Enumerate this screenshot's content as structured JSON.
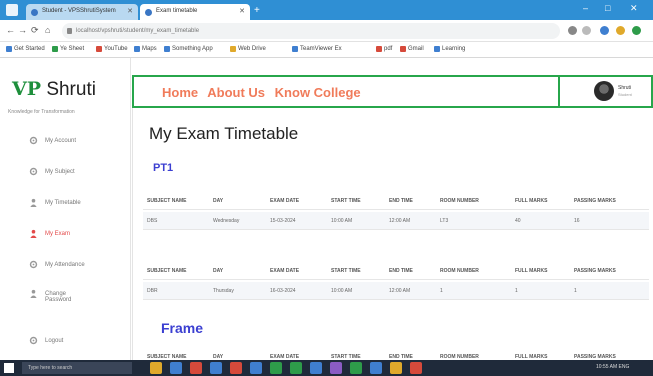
{
  "browser": {
    "tabs": [
      {
        "title": "Student - VPSShrutiSystem"
      },
      {
        "title": "Exam timetable"
      }
    ],
    "new_tab_symbol": "+",
    "window_controls": {
      "min": "–",
      "max": "□",
      "close": "✕"
    },
    "url": "localhost/vpshruti/student/my_exam_timetable",
    "nav": {
      "back": "←",
      "forward": "→",
      "reload": "⟳",
      "home": "⌂"
    },
    "bookmarks": [
      {
        "label": "Get Started",
        "color": "#3f7fd0"
      },
      {
        "label": "Ye Sheet",
        "color": "#2e9c4a"
      },
      {
        "label": "YouTube",
        "color": "#d64a3b"
      },
      {
        "label": "Maps",
        "color": "#3f7fd0"
      },
      {
        "label": "Something App",
        "color": "#3f7fd0"
      },
      {
        "label": "Web Drive",
        "color": "#e0a92b"
      },
      {
        "label": "TeamViewer Ex",
        "color": "#3f7fd0"
      },
      {
        "label": "pdf",
        "color": "#d64a3b"
      },
      {
        "label": "Gmail",
        "color": "#d64a3b"
      },
      {
        "label": "Learning",
        "color": "#3f7fd0"
      }
    ]
  },
  "sidebar": {
    "logo_mark": "VP",
    "logo_text": "Shruti",
    "tagline": "Knowledge for Transformation",
    "items": [
      {
        "label": "My Account",
        "icon": "gear-icon"
      },
      {
        "label": "My Subject",
        "icon": "gear-icon"
      },
      {
        "label": "My Timetable",
        "icon": "person-icon"
      },
      {
        "label": "My Exam",
        "icon": "person-icon",
        "active": true
      },
      {
        "label": "My Attendance",
        "icon": "gear-icon"
      },
      {
        "label": "Change",
        "label2": "Password",
        "icon": "person-icon"
      },
      {
        "label": "Logout",
        "icon": "gear-icon"
      }
    ]
  },
  "header": {
    "nav": [
      "Home",
      "About Us",
      "Know College"
    ],
    "user_name": "Shruti",
    "user_role": "Student",
    "colors": {
      "border": "#27a64b",
      "nav_text": "#f07b5a"
    }
  },
  "main": {
    "title": "My Exam Timetable",
    "columns": [
      "SUBJECT NAME",
      "DAY",
      "EXAM DATE",
      "START TIME",
      "END TIME",
      "ROOM NUMBER",
      "FULL MARKS",
      "PASSING MARKS"
    ],
    "exams": [
      {
        "name": "PT1",
        "rows": [
          [
            "DBS",
            "Wednesday",
            "15-03-2024",
            "10:00 AM",
            "12:00 AM",
            "LT3",
            "40",
            "16"
          ]
        ]
      },
      {
        "name": "",
        "rows": [
          [
            "DBR",
            "Thursday",
            "16-03-2024",
            "10:00 AM",
            "12:00 AM",
            "1",
            "1",
            "1"
          ]
        ]
      },
      {
        "name": "Frame",
        "rows": []
      }
    ],
    "accent_color": "#3b3fd1"
  },
  "taskbar": {
    "search_placeholder": "Type here to search",
    "clock": "10:55 AM  ENG"
  }
}
